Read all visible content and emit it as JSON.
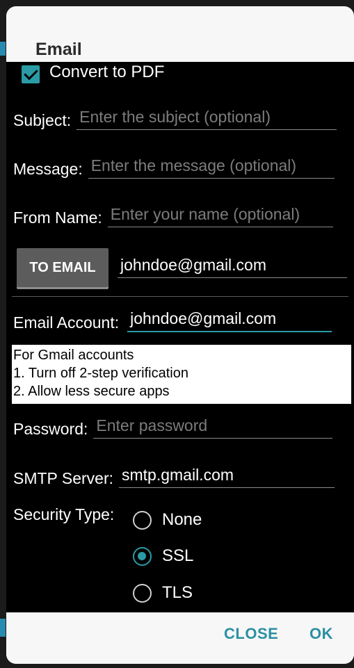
{
  "dialog": {
    "title": "Email"
  },
  "convert": {
    "label": "Convert to PDF",
    "checked": true
  },
  "subject": {
    "label": "Subject:",
    "placeholder": "Enter the subject (optional)"
  },
  "message": {
    "label": "Message:",
    "placeholder": "Enter the message (optional)"
  },
  "from_name": {
    "label": "From Name:",
    "placeholder": "Enter your name (optional)"
  },
  "to_email": {
    "button": "TO EMAIL",
    "value": "johndoe@gmail.com"
  },
  "account": {
    "label": "Email Account:",
    "value": "johndoe@gmail.com"
  },
  "info": {
    "line1": "For Gmail accounts",
    "line2": "1. Turn off 2-step verification",
    "line3": "2. Allow less secure apps"
  },
  "password": {
    "label": "Password:",
    "placeholder": "Enter password"
  },
  "smtp": {
    "label": "SMTP Server:",
    "value": "smtp.gmail.com"
  },
  "security": {
    "label": "Security Type:",
    "options": [
      "None",
      "SSL",
      "TLS"
    ],
    "selected": "SSL"
  },
  "footer": {
    "close": "CLOSE",
    "ok": "OK"
  },
  "colors": {
    "accent": "#2a9ba6",
    "button_text": "#2b8fa3"
  }
}
